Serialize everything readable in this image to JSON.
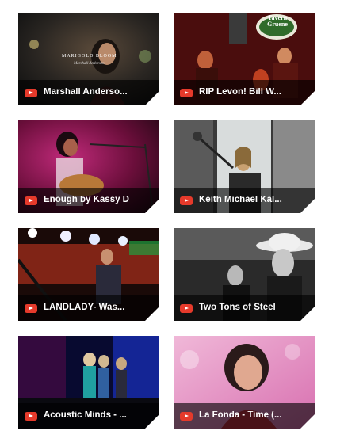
{
  "videos": [
    {
      "title": "Marshall Anderso...",
      "thumb_overlay": "MARIGOLD BLOOM",
      "thumb_overlay_sub": "Marshall Anderson"
    },
    {
      "title": "RIP Levon! Bill W...",
      "thumb_sign": "Tavern Gruene"
    },
    {
      "title": "Enough by Kassy D"
    },
    {
      "title": "Keith Michael Kal..."
    },
    {
      "title": "LANDLADY- Was..."
    },
    {
      "title": "Two Tons of Steel"
    },
    {
      "title": "Acoustic Minds - ..."
    },
    {
      "title": "La Fonda - Time (..."
    }
  ],
  "icons": {
    "play": "youtube-play-icon"
  },
  "colors": {
    "youtube_red": "#e53a2b",
    "caption_bg": "rgba(0,0,0,0.62)"
  }
}
